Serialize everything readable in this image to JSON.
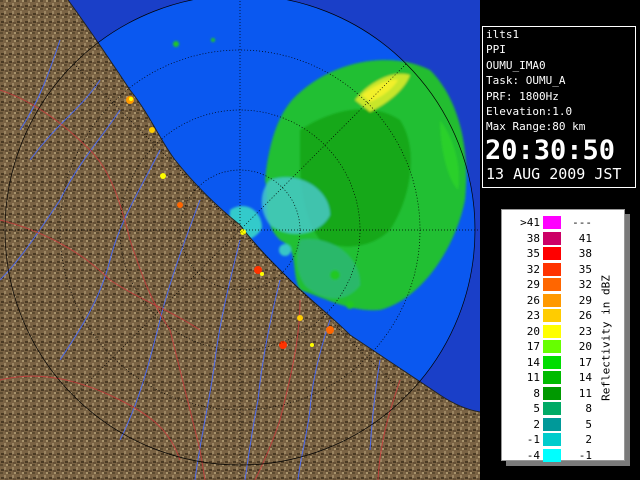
{
  "info": {
    "radar_id": "ilts1",
    "mode": "PPI",
    "product": "OUMU_IMA0",
    "task": "Task: OUMU_A",
    "prf": "PRF: 1800Hz",
    "elevation": "Elevation:1.0",
    "max_range": "Max Range:80 km",
    "time": "20:30:50",
    "date": "13 AUG 2009 JST"
  },
  "legend": {
    "caption": "Reflectivity in dBZ",
    "rows": [
      {
        "lo": ">41",
        "hi": "---",
        "color": "#ff00ff"
      },
      {
        "lo": "38",
        "hi": "41",
        "color": "#cc0066"
      },
      {
        "lo": "35",
        "hi": "38",
        "color": "#ff0000"
      },
      {
        "lo": "32",
        "hi": "35",
        "color": "#ff3300"
      },
      {
        "lo": "29",
        "hi": "32",
        "color": "#ff6600"
      },
      {
        "lo": "26",
        "hi": "29",
        "color": "#ff9900"
      },
      {
        "lo": "23",
        "hi": "26",
        "color": "#ffcc00"
      },
      {
        "lo": "20",
        "hi": "23",
        "color": "#ffff00"
      },
      {
        "lo": "17",
        "hi": "20",
        "color": "#66ff00"
      },
      {
        "lo": "14",
        "hi": "17",
        "color": "#00dd00"
      },
      {
        "lo": "11",
        "hi": "14",
        "color": "#00bb00"
      },
      {
        "lo": "8",
        "hi": "11",
        "color": "#009900"
      },
      {
        "lo": "5",
        "hi": "8",
        "color": "#00aa66"
      },
      {
        "lo": "2",
        "hi": "5",
        "color": "#009999"
      },
      {
        "lo": "-1",
        "hi": "2",
        "color": "#00cccc"
      },
      {
        "lo": "-4",
        "hi": "-1",
        "color": "#00ffff"
      }
    ]
  },
  "colors": {
    "sea_inside_range": "#0a58f0",
    "sea_outside_range": "#1a3fc8",
    "land": "#7a6344",
    "rivers": "#4a6cff",
    "borders": "#c83c3c",
    "range_rings": "#000000"
  }
}
